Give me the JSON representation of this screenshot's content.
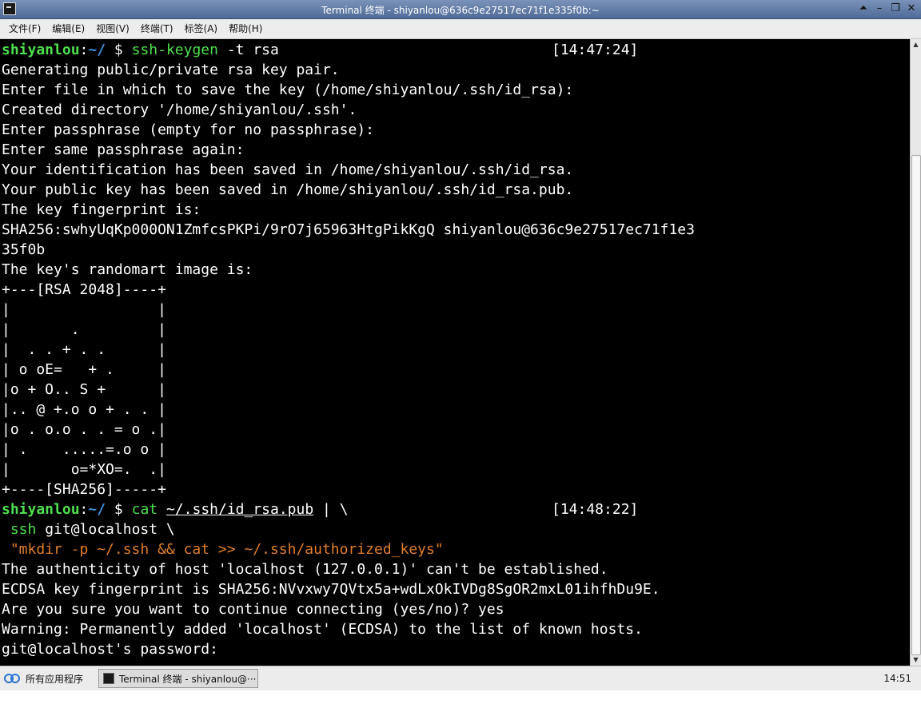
{
  "window": {
    "title": "Terminal 终端 - shiyanlou@636c9e27517ec71f1e335f0b:~",
    "buttons": [
      "⏶",
      "–",
      "❐",
      "✕"
    ]
  },
  "menu": [
    "文件(F)",
    "编辑(E)",
    "视图(V)",
    "终端(T)",
    "标签(A)",
    "帮助(H)"
  ],
  "prompt": {
    "user": "shiyanlou",
    "path": "~/",
    "symbol": "$"
  },
  "terminal": {
    "cmd1": {
      "program": "ssh-keygen",
      "args": "-t rsa",
      "time": "[14:47:24]"
    },
    "output1": [
      "Generating public/private rsa key pair.",
      "Enter file in which to save the key (/home/shiyanlou/.ssh/id_rsa):",
      "Created directory '/home/shiyanlou/.ssh'.",
      "Enter passphrase (empty for no passphrase):",
      "Enter same passphrase again:",
      "Your identification has been saved in /home/shiyanlou/.ssh/id_rsa.",
      "Your public key has been saved in /home/shiyanlou/.ssh/id_rsa.pub.",
      "The key fingerprint is:",
      "SHA256:swhyUqKp000ON1ZmfcsPKPi/9rO7j65963HtgPikKgQ shiyanlou@636c9e27517ec71f1e3",
      "35f0b",
      "The key's randomart image is:",
      "+---[RSA 2048]----+",
      "|                 |",
      "|       .         |",
      "|  . . + . .      |",
      "| o oE=   + .     |",
      "|o + O.. S +      |",
      "|.. @ +.o o + . . |",
      "|o . o.o . . = o .|",
      "| .    .....=.o o |",
      "|       o=*XO=.  .|",
      "+----[SHA256]-----+"
    ],
    "cmd2": {
      "program": "cat",
      "file": "~/.ssh/id_rsa.pub",
      "rest": " | \\",
      "time": "[14:48:22]"
    },
    "cmd2_line2": {
      "program": "ssh",
      "rest": " git@localhost \\"
    },
    "cmd2_line3": "\"mkdir -p ~/.ssh && cat >> ~/.ssh/authorized_keys\"",
    "output2": [
      "The authenticity of host 'localhost (127.0.0.1)' can't be established.",
      "ECDSA key fingerprint is SHA256:NVvxwy7QVtx5a+wdLxOkIVDg8SgOR2mxL01ihfhDu9E.",
      "Are you sure you want to continue connecting (yes/no)? yes",
      "Warning: Permanently added 'localhost' (ECDSA) to the list of known hosts.",
      "git@localhost's password: "
    ]
  },
  "taskbar": {
    "start_label": "所有应用程序",
    "task_label": "Terminal 终端 - shiyanlou@···",
    "clock": "14:51"
  }
}
